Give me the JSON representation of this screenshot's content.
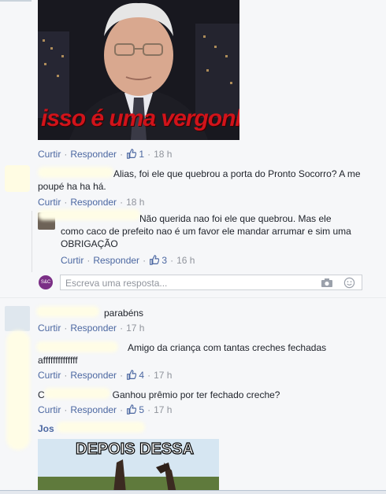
{
  "comments": [
    {
      "text": "Alias, foi ele que quebrou a porta do Pronto Socorro? A me poupé ha ha há.",
      "line1": "Alias, foi ele que quebrou a porta do Pronto Socorro? A me",
      "line2": "poupé ha ha há.",
      "actions": {
        "like": "Curtir",
        "reply": "Responder",
        "time": "18 h"
      }
    },
    {
      "line1": "Não querida nao foi ele que quebrou. Mas ele",
      "line2": "como caco de prefeito nao é um favor ele mandar arrumar e sim uma",
      "line3": "OBRIGAÇÃO",
      "actions": {
        "like": "Curtir",
        "reply": "Responder",
        "count": "3",
        "time": "16 h"
      }
    },
    {
      "line1": "parabéns",
      "actions": {
        "like": "Curtir",
        "reply": "Responder",
        "time": "17 h"
      }
    },
    {
      "line1": "Amigo da criança com tantas creches fechadas",
      "line2": "affffffffffffff",
      "actions": {
        "like": "Curtir",
        "reply": "Responder",
        "count": "4",
        "time": "17 h"
      }
    },
    {
      "prefix": "C",
      "line1": "Ganhou prêmio por ter fechado creche?",
      "actions": {
        "like": "Curtir",
        "reply": "Responder",
        "count": "5",
        "time": "17 h"
      }
    }
  ],
  "first_post_actions": {
    "like": "Curtir",
    "reply": "Responder",
    "count": "1",
    "time": "18 h"
  },
  "first_image_caption": "isso é uma vergonha",
  "reply_box": {
    "placeholder": "Escreva uma resposta...",
    "avatar_text": "S&C"
  },
  "partial_name": "Jos",
  "second_image_caption": "DEPOIS DESSA",
  "colors": {
    "link": "#4b67a1",
    "meta": "#90949c",
    "background": "#f6f7f9",
    "caption_red": "#d1131a"
  }
}
